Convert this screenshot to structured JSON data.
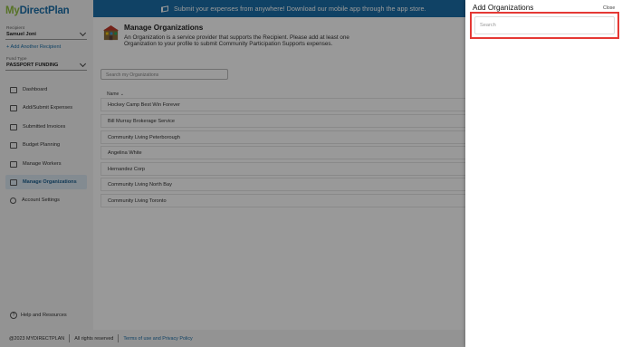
{
  "sidebar": {
    "logo_part1": "My",
    "logo_part2": "DirectPlan",
    "recipient_label": "Recipient",
    "recipient_value": "Samuel Joni",
    "add_recipient": "+ Add Another Recipient",
    "fund_type_label": "Fund Type",
    "fund_type_value": "PASSPORT FUNDING",
    "items": [
      {
        "label": "Dashboard",
        "icon": "dashboard-icon"
      },
      {
        "label": "Add/Submit Expenses",
        "icon": "expenses-icon"
      },
      {
        "label": "Submitted Invoices",
        "icon": "invoices-icon"
      },
      {
        "label": "Budget Planning",
        "icon": "budget-icon"
      },
      {
        "label": "Manage Workers",
        "icon": "workers-icon"
      },
      {
        "label": "Manage Organizations",
        "icon": "organizations-icon",
        "active": true
      },
      {
        "label": "Account Settings",
        "icon": "user-icon"
      }
    ],
    "help": "Help and Resources"
  },
  "banner": {
    "text": "Submit your expenses from anywhere! Download our mobile app through the app store.",
    "icon": "megaphone-icon"
  },
  "main": {
    "title": "Manage Organizations",
    "description": "An Organization is a service provider that supports the Recipient. Please add at least one Organization to your profile to submit Community Participation Supports expenses.",
    "search_placeholder": "Search my Organizations",
    "column_header": "Name",
    "organizations": [
      "Hockey Camp Best Win Forever",
      "Bill Murray Brokerage Service",
      "Community Living Peterborough",
      "Angelina White",
      "Hernandez Corp",
      "Community Living North Bay",
      "Community Living Toronto"
    ]
  },
  "footer": {
    "copyright": "@2023 MYDIRECTPLAN",
    "rights": "All rights reserved",
    "terms_link": "Terms of use and Privacy Policy"
  },
  "drawer": {
    "title": "Add Organizations",
    "close_label": "Close",
    "search_placeholder": "Search"
  },
  "colors": {
    "brand_blue": "#1b6fa8",
    "brand_green": "#8fbf3f",
    "highlight_red": "#e53935"
  }
}
